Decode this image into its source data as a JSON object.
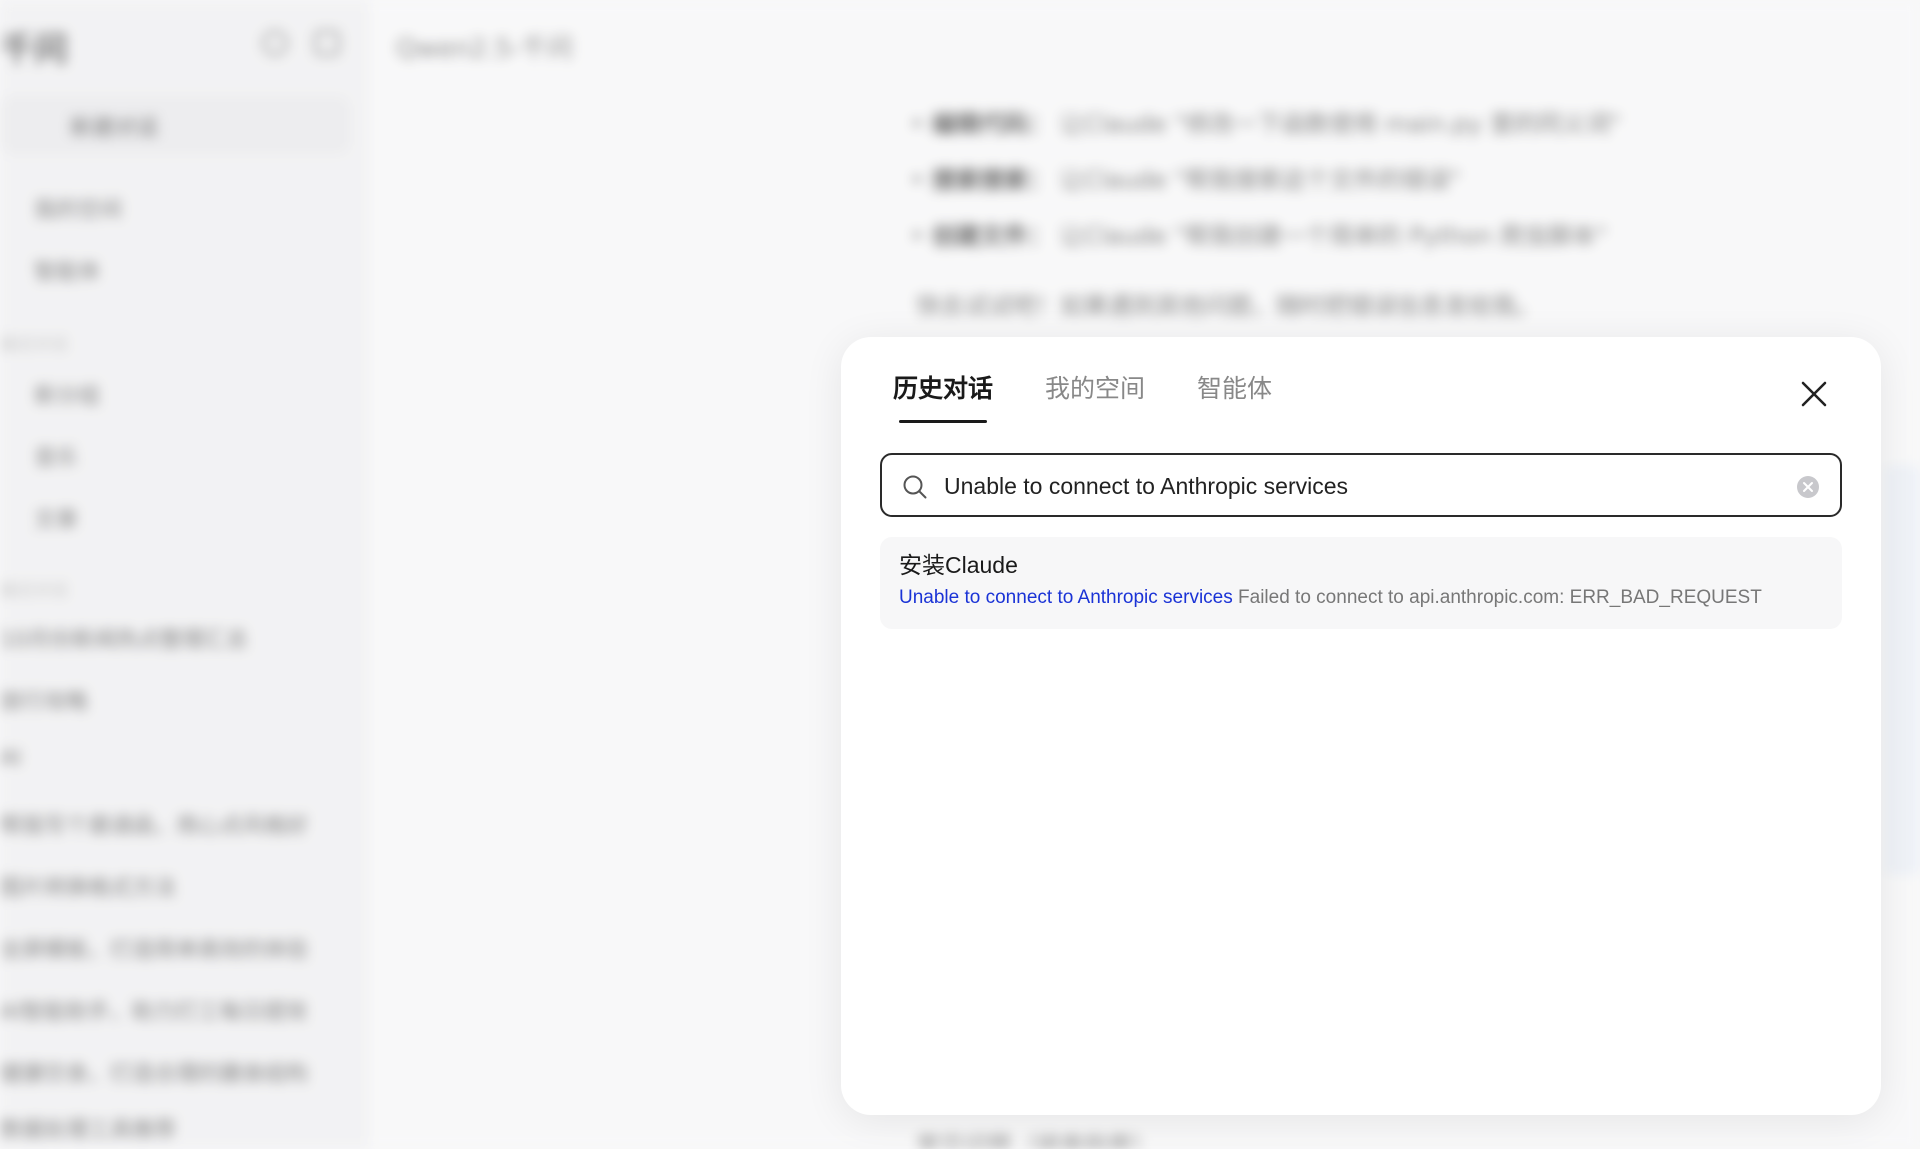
{
  "background": {
    "brand": "千问",
    "new_chat": "新建对话",
    "nav": [
      "我的空间",
      "智能体"
    ],
    "section_label": "最近对话",
    "groups": [
      "新分组",
      "音乐",
      "文章"
    ],
    "history": [
      "10月份新闻热点整理汇总",
      "旅行攻略",
      "AI",
      "帮我写个邀请函，用心点风格好",
      "图片转换格式方法",
      "全屏模板，打造简单高效的体验",
      "AI智能助手，助力打工每日提效",
      "健康饮食，打造合理的膳食结构",
      "数据处理工具推荐"
    ],
    "model_title": "Qwen2.5-千问",
    "lines": [
      {
        "bold": "编辑代码：",
        "text": "让Claude \"修改一下函数使用 main.py 里的同义词\""
      },
      {
        "bold": "搜索搜索：",
        "text": "让Claude \"帮我搜索这个文件的错误\""
      },
      {
        "bold": "创建文件：",
        "text": "让Claude \"帮我创建一个简单的 Python 爬虫脚本\""
      }
    ],
    "tip": "快去试试吧！如果遇到其他问题，随时把错误信息发给我。",
    "bottom": "常见问题（排查指南）"
  },
  "modal": {
    "tabs": [
      {
        "label": "历史对话",
        "active": true
      },
      {
        "label": "我的空间",
        "active": false
      },
      {
        "label": "智能体",
        "active": false
      }
    ],
    "search": {
      "value": "Unable to connect to Anthropic services",
      "placeholder": ""
    },
    "results": [
      {
        "title": "安装Claude",
        "highlight": "Unable to connect to Anthropic services",
        "rest": " Failed to connect to api.anthropic.com: ERR_BAD_REQUEST"
      }
    ]
  },
  "colors": {
    "highlight": "#1a33d6",
    "active_tab": "#1a1a1a",
    "inactive_tab": "#888888"
  }
}
